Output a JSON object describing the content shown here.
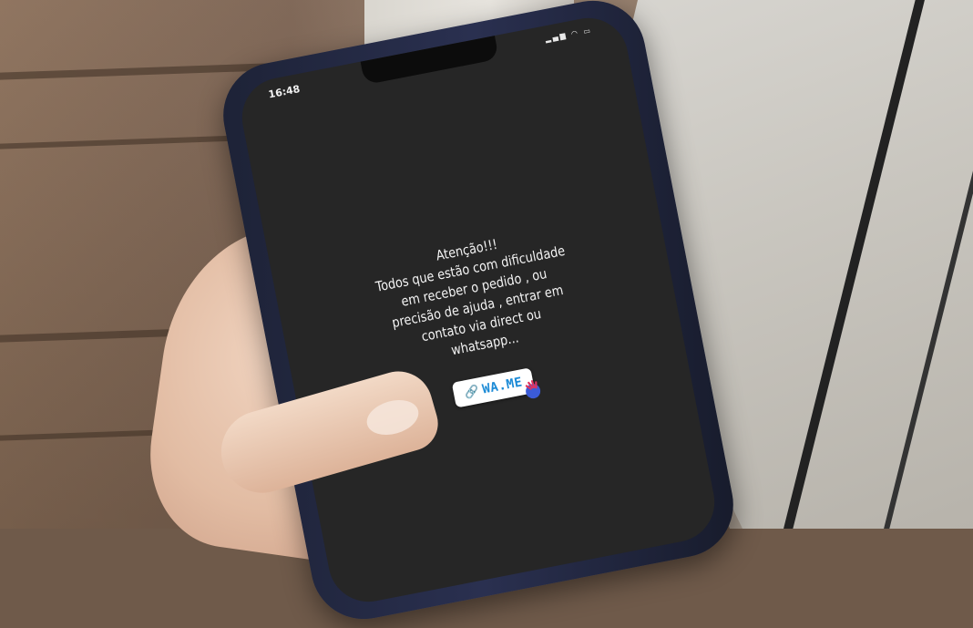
{
  "phone": {
    "status_time": "16:48",
    "status_icons": "signal wifi battery"
  },
  "story": {
    "lines": [
      "Atenção!!!",
      "Todos que estão com dificuldade",
      "em receber o pedido , ou",
      "precisão de ajuda , entrar em",
      "contato via direct ou",
      "whatsapp..."
    ],
    "link_sticker": {
      "icon": "link-icon",
      "label": "WA.ME"
    },
    "tap_icon": "tap-hand-icon"
  },
  "colors": {
    "screen_bg": "#262626",
    "text": "#f4f4f4",
    "link_blue": "#1b8ad6",
    "phone_case": "#1d2236"
  }
}
